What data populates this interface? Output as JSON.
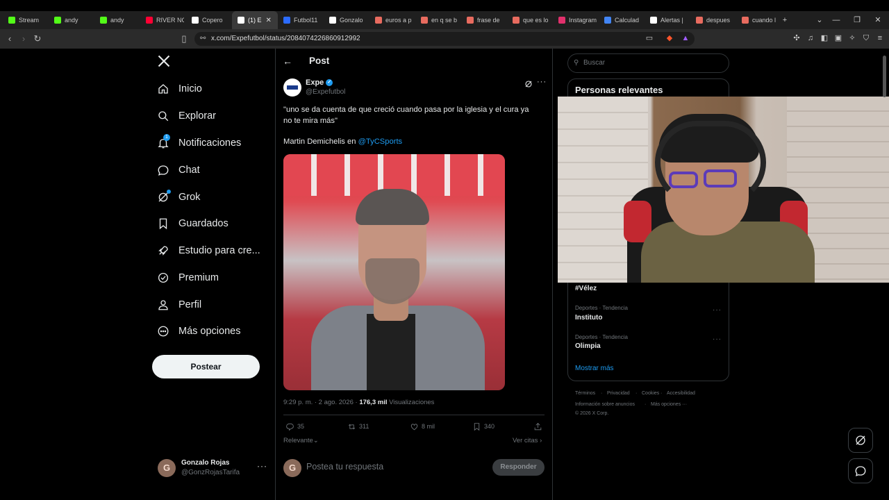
{
  "browser": {
    "tabs": [
      {
        "title": "Stream",
        "icon": "kick-icon",
        "color": "#53fc18"
      },
      {
        "title": "andy",
        "icon": "kick-icon",
        "color": "#53fc18"
      },
      {
        "title": "andy",
        "icon": "kick-icon",
        "color": "#53fc18"
      },
      {
        "title": "RIVER NC",
        "icon": "youtube-icon",
        "color": "#ff0033"
      },
      {
        "title": "Copero",
        "icon": "x-icon",
        "color": "#ffffff"
      },
      {
        "title": "(1) E",
        "icon": "x-icon",
        "color": "#ffffff"
      },
      {
        "title": "Futbol11",
        "icon": "futbol-icon",
        "color": "#2b6bff"
      },
      {
        "title": "Gonzalo",
        "icon": "tiktok-icon",
        "color": "#ffffff"
      },
      {
        "title": "euros a p",
        "icon": "perplexity-icon",
        "color": "#e86b5f"
      },
      {
        "title": "en q se b",
        "icon": "perplexity-icon",
        "color": "#e86b5f"
      },
      {
        "title": "frase de",
        "icon": "perplexity-icon",
        "color": "#e86b5f"
      },
      {
        "title": "que es lo",
        "icon": "perplexity-icon",
        "color": "#e86b5f"
      },
      {
        "title": "Instagram",
        "icon": "instagram-icon",
        "color": "#e1306c"
      },
      {
        "title": "Calculad",
        "icon": "google-icon",
        "color": "#4285f4"
      },
      {
        "title": "Alertas |",
        "icon": "streamelements-icon",
        "color": "#ffffff"
      },
      {
        "title": "despues",
        "icon": "perplexity-icon",
        "color": "#e86b5f"
      },
      {
        "title": "cuando l",
        "icon": "perplexity-icon",
        "color": "#e86b5f"
      }
    ],
    "url": "x.com/Expefutbol/status/2084074226860912992"
  },
  "nav": {
    "items": [
      {
        "label": "Inicio",
        "icon": "home-icon"
      },
      {
        "label": "Explorar",
        "icon": "search-icon"
      },
      {
        "label": "Notificaciones",
        "icon": "bell-icon",
        "badge": "1"
      },
      {
        "label": "Chat",
        "icon": "chat-icon"
      },
      {
        "label": "Grok",
        "icon": "grok-icon"
      },
      {
        "label": "Guardados",
        "icon": "bookmark-icon"
      },
      {
        "label": "Estudio para cre...",
        "icon": "rocket-icon"
      },
      {
        "label": "Premium",
        "icon": "verified-icon"
      },
      {
        "label": "Perfil",
        "icon": "person-icon"
      },
      {
        "label": "Más opciones",
        "icon": "more-circle-icon"
      }
    ],
    "post_button": "Postear"
  },
  "account": {
    "name": "Gonzalo Rojas",
    "handle": "@GonzRojasTarifa",
    "initial": "G"
  },
  "post": {
    "header": "Post",
    "author_name": "Expe",
    "author_handle": "@Expefutbol",
    "text_line1": "\"uno se da cuenta de que creció cuando pasa por la iglesia y el cura ya",
    "text_line2": "no te mira más\"",
    "mention_prefix": "Martin Demichelis en ",
    "mention": "@TyCSports",
    "time": "9:29 p. m. · 2 ago. 2026 · ",
    "views_count": "176,3 mil",
    "views_label": " Visualizaciones",
    "replies": "35",
    "reposts": "311",
    "likes": "8 mil",
    "bookmarks": "340",
    "sort_label": "Relevante",
    "quotes_label": "Ver citas",
    "reply_placeholder": "Postea tu respuesta",
    "reply_button": "Responder"
  },
  "sidebar": {
    "search_placeholder": "Buscar",
    "relevant_title": "Personas relevantes",
    "trends": [
      {
        "category": "",
        "name": "#Vélez"
      },
      {
        "category": "Deportes · Tendencia",
        "name": "Instituto"
      },
      {
        "category": "Deportes · Tendencia",
        "name": "Olimpia"
      }
    ],
    "show_more": "Mostrar más",
    "footer": {
      "line1": [
        "Términos",
        "Privacidad",
        "Cookies",
        "Accesibilidad"
      ],
      "line2": [
        "Información sobre anuncios",
        "Más opciones ···"
      ],
      "copyright": "© 2026 X Corp."
    }
  },
  "colors": {
    "accent": "#1d9bf0",
    "background": "#000000",
    "border": "#2f3336"
  }
}
